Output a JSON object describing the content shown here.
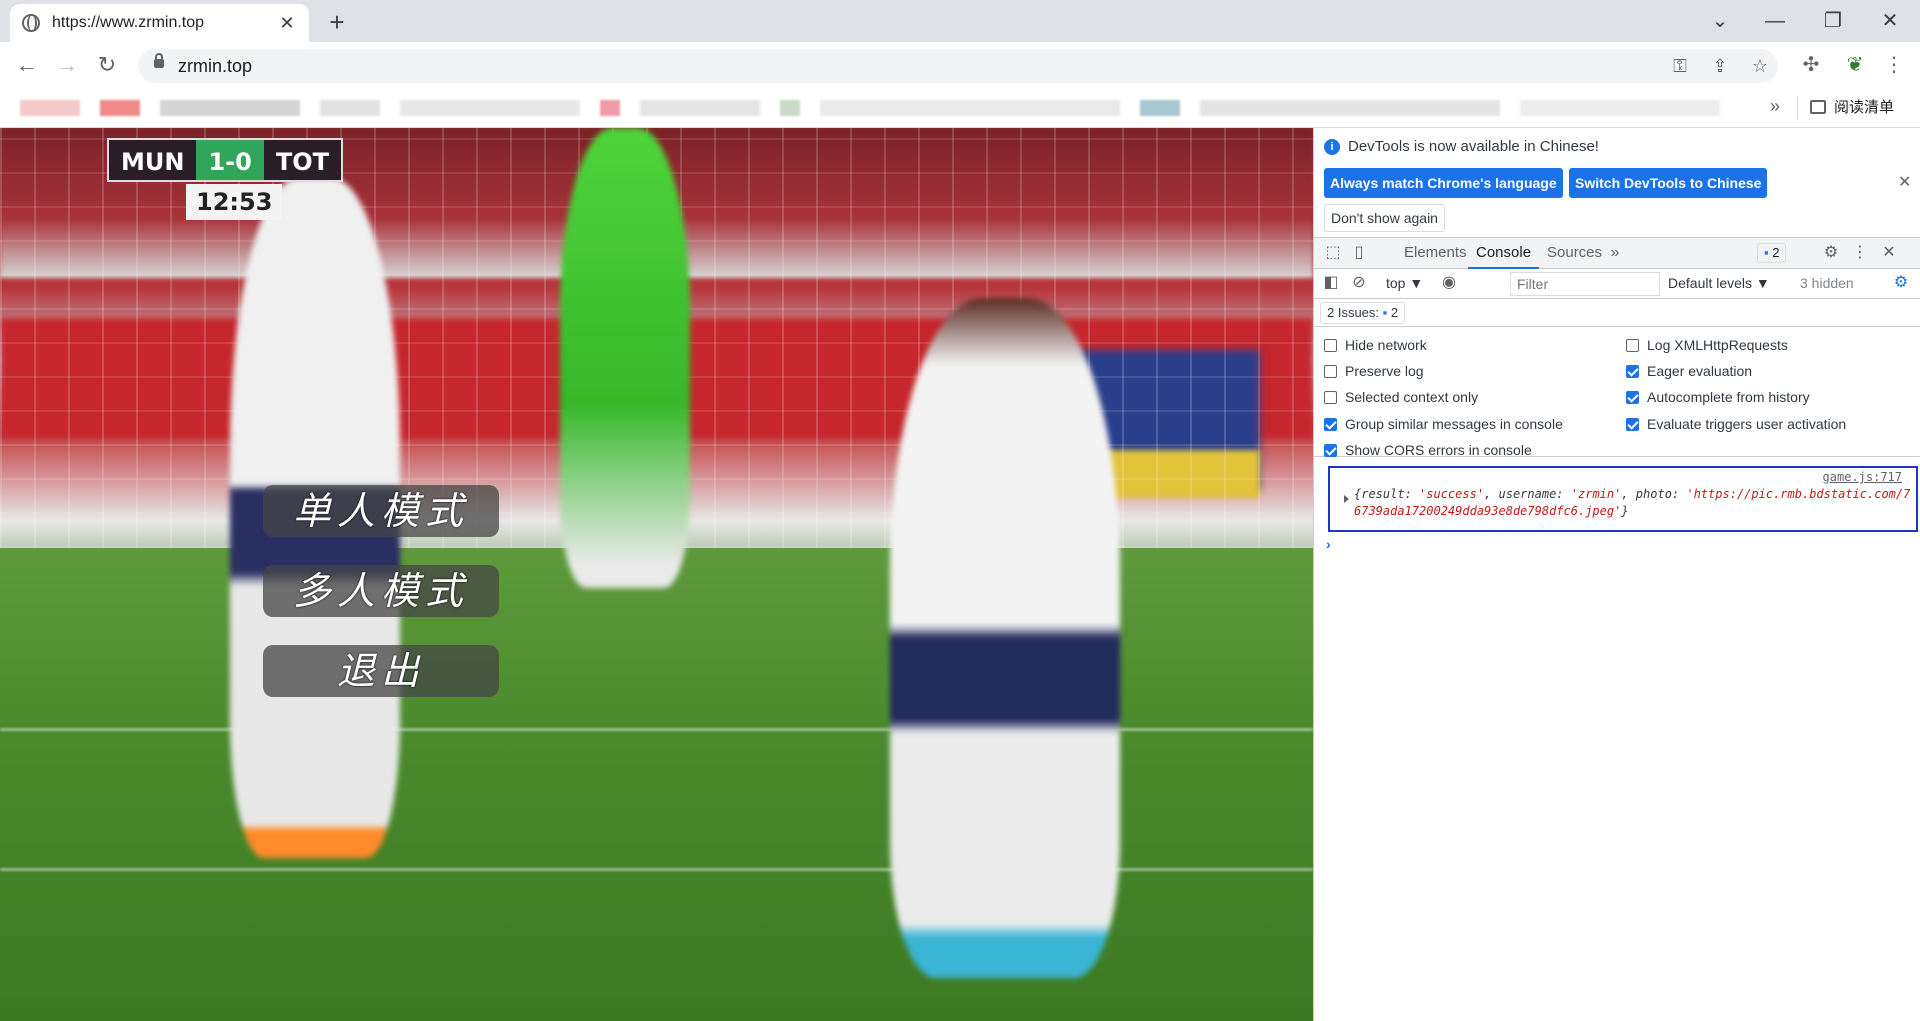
{
  "browser": {
    "tab_title": "https://www.zrmin.top",
    "url": "zrmin.top",
    "bookmarks_more": "»",
    "reading_list": "阅读清单"
  },
  "game": {
    "scoreboard": {
      "home": "MUN",
      "score": "1-0",
      "away": "TOT",
      "clock": "12:53"
    },
    "menu": [
      "单人模式",
      "多人模式",
      "退出"
    ]
  },
  "devtools": {
    "info": "DevTools is now available in Chinese!",
    "btn_match": "Always match Chrome's language",
    "btn_switch": "Switch DevTools to Chinese",
    "btn_dont_show": "Don't show again",
    "tabs": [
      "Elements",
      "Console",
      "Sources"
    ],
    "tabs_more": "»",
    "issues_badge": "2",
    "context": "top ▼",
    "filter_placeholder": "Filter",
    "levels": "Default levels ▼",
    "hidden": "3 hidden",
    "issues_label": "2 Issues:",
    "issues_count": "2",
    "settings_left": [
      {
        "label": "Hide network",
        "checked": false
      },
      {
        "label": "Preserve log",
        "checked": false
      },
      {
        "label": "Selected context only",
        "checked": false
      },
      {
        "label": "Group similar messages in console",
        "checked": true
      },
      {
        "label": "Show CORS errors in console",
        "checked": true
      }
    ],
    "settings_right": [
      {
        "label": "Log XMLHttpRequests",
        "checked": false
      },
      {
        "label": "Eager evaluation",
        "checked": true
      },
      {
        "label": "Autocomplete from history",
        "checked": true
      },
      {
        "label": "Evaluate triggers user activation",
        "checked": true
      }
    ],
    "log": {
      "source": "game.js:717",
      "open": "{result: ",
      "result": "'success'",
      "k2": ", username: ",
      "username": "'zrmin'",
      "k3": ", photo: ",
      "photo": "'https://pic.rmb.bdstatic.com/76739ada17200249dda93e8de798dfc6.jpeg'",
      "close": "}"
    },
    "prompt": "›"
  },
  "colors": {
    "accent": "#1a73e8",
    "highlight_border": "#1a37c9",
    "string": "#c41a16"
  }
}
